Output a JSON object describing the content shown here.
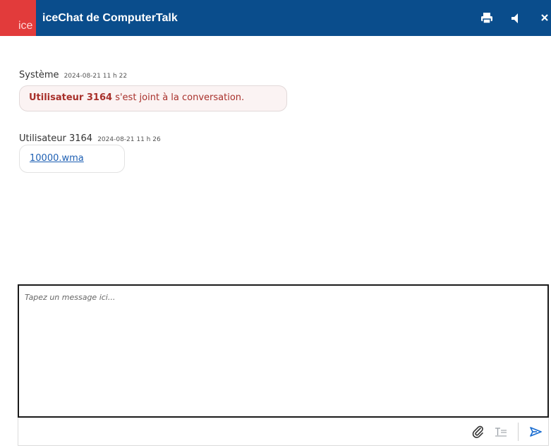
{
  "header": {
    "logo_text": "ice",
    "title": "iceChat de ComputerTalk",
    "icons": [
      "print-icon",
      "speaker-icon",
      "close-icon"
    ],
    "color": "#0a4d8c",
    "logo_color": "#e23b3b"
  },
  "messages": [
    {
      "sender": "Système",
      "time": "2024-08-21 11 h 22",
      "user": "Utilisateur 3164",
      "text": " s'est joint à la conversation."
    },
    {
      "sender": "Utilisateur 3164",
      "time": "2024-08-21 11 h 26",
      "file": "10000.wma"
    }
  ],
  "compose": {
    "placeholder": "Tapez un message ici...",
    "value": ""
  },
  "toolbar": {
    "icons": [
      "paperclip-icon",
      "text-format-icon",
      "send-icon"
    ]
  }
}
